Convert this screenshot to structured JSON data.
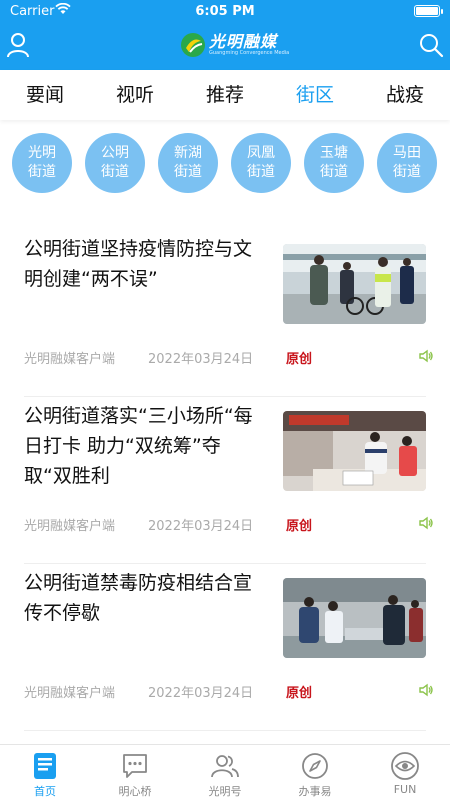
{
  "status_bar": {
    "carrier": "Carrier",
    "time": "6:05 PM"
  },
  "app": {
    "logo_name": "光明融媒",
    "logo_subtitle": "Guangming Convergence Media"
  },
  "tabs": [
    {
      "label": "要闻"
    },
    {
      "label": "视听"
    },
    {
      "label": "推荐"
    },
    {
      "label": "街区",
      "active": true
    },
    {
      "label": "战疫"
    }
  ],
  "streets": [
    {
      "line1": "光明",
      "line2": "街道"
    },
    {
      "line1": "公明",
      "line2": "街道"
    },
    {
      "line1": "新湖",
      "line2": "街道"
    },
    {
      "line1": "凤凰",
      "line2": "街道"
    },
    {
      "line1": "玉塘",
      "line2": "街道"
    },
    {
      "line1": "马田",
      "line2": "街道"
    }
  ],
  "news": [
    {
      "title": "公明街道坚持疫情防控与文明创建“两不误”",
      "source": "光明融媒客户端",
      "date": "2022年03月24日",
      "tag": "原创"
    },
    {
      "title": "公明街道落实“三小场所“每日打卡 助力“双统筹”夺取“双胜利",
      "source": "光明融媒客户端",
      "date": "2022年03月24日",
      "tag": "原创"
    },
    {
      "title": "公明街道禁毒防疫相结合宣传不停歇",
      "source": "光明融媒客户端",
      "date": "2022年03月24日",
      "tag": "原创"
    }
  ],
  "tabbar": [
    {
      "label": "首页",
      "icon": "news-home-icon",
      "active": true
    },
    {
      "label": "明心桥",
      "icon": "chat-bubble-icon"
    },
    {
      "label": "光明号",
      "icon": "people-icon"
    },
    {
      "label": "办事易",
      "icon": "compass-icon"
    },
    {
      "label": "FUN",
      "icon": "eye-icon"
    }
  ],
  "colors": {
    "brand": "#1a9ff0",
    "street_circle": "#7bc1f2",
    "original_tag": "#c8151c",
    "audio_icon": "#8bc34a"
  }
}
